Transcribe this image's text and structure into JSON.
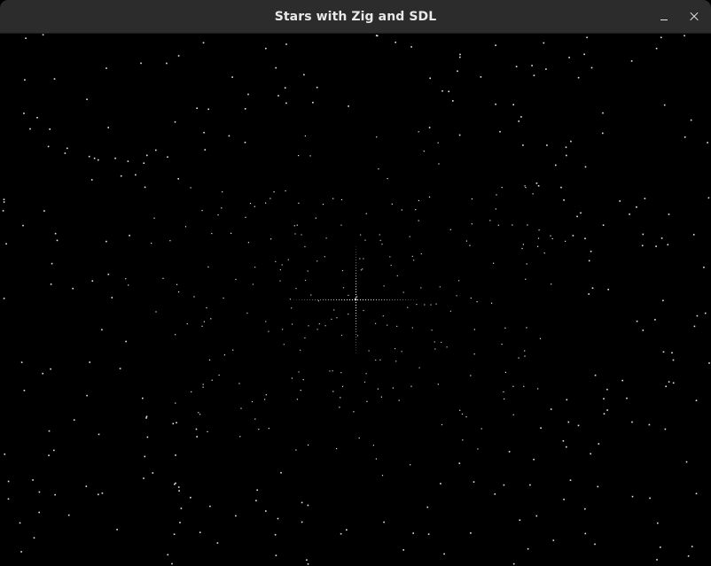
{
  "window": {
    "title": "Stars with Zig and SDL",
    "buttons": {
      "minimize_icon": "minimize-icon",
      "close_icon": "close-icon"
    }
  },
  "scene": {
    "background_color": "#000000",
    "star_color": "#ffffff",
    "titlebar_color": "#2c2c2c"
  }
}
